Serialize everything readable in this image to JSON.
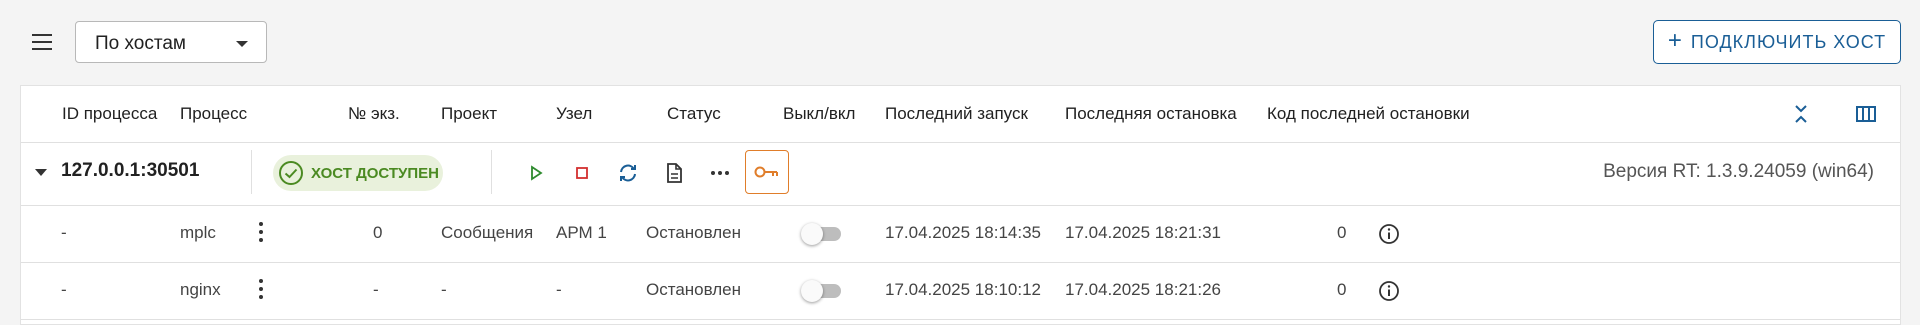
{
  "toolbar": {
    "group_select_value": "По хостам",
    "connect_label": "ПОДКЛЮЧИТЬ ХОСТ"
  },
  "table": {
    "headers": [
      "ID процесса",
      "Процесс",
      "№ экз.",
      "Проект",
      "Узел",
      "Статус",
      "Выкл/вкл",
      "Последний запуск",
      "Последняя остановка",
      "Код последней остановки"
    ],
    "host": {
      "address": "127.0.0.1:30501",
      "status": "ХОСТ ДОСТУПЕН",
      "version": "Версия RT: 1.3.9.24059 (win64)"
    },
    "rows": [
      {
        "pid": "-",
        "process": "mplc",
        "instance": "0",
        "project": "Сообщения",
        "node": "АРМ 1",
        "status": "Остановлен",
        "enabled": false,
        "last_start": "17.04.2025 18:14:35",
        "last_stop": "17.04.2025 18:21:31",
        "stop_code": "0"
      },
      {
        "pid": "-",
        "process": "nginx",
        "instance": "-",
        "project": "-",
        "node": "-",
        "status": "Остановлен",
        "enabled": false,
        "last_start": "17.04.2025 18:10:12",
        "last_stop": "17.04.2025 18:21:26",
        "stop_code": "0"
      }
    ]
  },
  "colors": {
    "accent": "#1a5e96",
    "success": "#4b8a22",
    "success_bg": "#e9f1dc",
    "play": "#2e8b2e",
    "stop": "#d32f2f",
    "key": "#e07d2a"
  },
  "icons": [
    "menu-icon",
    "chevron-down-icon",
    "plus-icon",
    "collapse-all-icon",
    "columns-icon",
    "check-circle-icon",
    "play-icon",
    "stop-icon",
    "restart-icon",
    "document-icon",
    "more-horizontal-icon",
    "key-icon",
    "kebab-icon",
    "info-icon"
  ]
}
